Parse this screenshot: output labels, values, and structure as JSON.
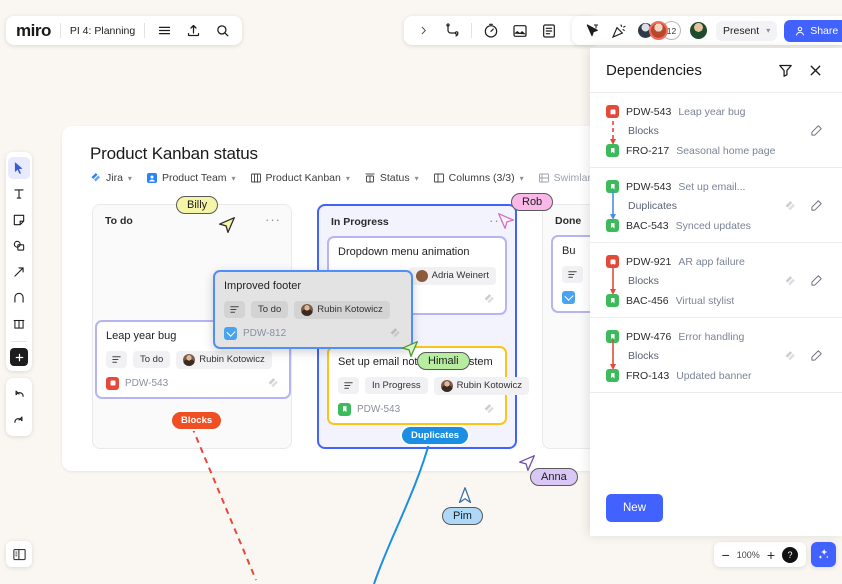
{
  "app": {
    "logo": "miro",
    "board_name": "PI 4: Planning",
    "present_label": "Present",
    "share_label": "Share",
    "avatar_overflow_count": "12"
  },
  "board": {
    "title": "Product Kanban status",
    "toolbar": [
      {
        "label": "Jira",
        "icon": "jira-icon"
      },
      {
        "label": "Product Team",
        "icon": "team-icon"
      },
      {
        "label": "Product Kanban",
        "icon": "board-icon"
      },
      {
        "label": "Status",
        "icon": "status-icon"
      },
      {
        "label": "Columns (3/3)",
        "icon": "columns-icon"
      },
      {
        "label": "Swimlanes",
        "icon": "swimlanes-icon"
      }
    ],
    "columns": [
      {
        "name": "To do"
      },
      {
        "name": "In Progress"
      },
      {
        "name": "Done"
      }
    ],
    "cards": {
      "leap_year": {
        "title": "Leap year bug",
        "status": "To do",
        "assignee": "Rubin Kotowicz",
        "key": "PDW-543"
      },
      "improved_footer": {
        "title": "Improved footer",
        "status": "To do",
        "assignee": "Rubin Kotowicz",
        "key": "PDW-812"
      },
      "dropdown": {
        "title": "Dropdown menu animation",
        "assignee": "Adria Weinert"
      },
      "email_notif": {
        "title": "Set up email notification system",
        "status": "In Progress",
        "assignee": "Rubin Kotowicz",
        "key": "PDW-543"
      },
      "done_card": {
        "title": "Bu"
      }
    },
    "connector_labels": {
      "blocks": "Blocks",
      "duplicates": "Duplicates"
    }
  },
  "cursors": [
    {
      "name": "Billy",
      "color": "#f5f5a8",
      "border": "#2b2b2b"
    },
    {
      "name": "Rob",
      "color": "#f9b8e8",
      "border": "#2b2b2b"
    },
    {
      "name": "Himali",
      "color": "#b7eda0",
      "border": "#2b2b2b"
    },
    {
      "name": "Anna",
      "color": "#d9c7f5",
      "border": "#2b2b2b"
    },
    {
      "name": "Pim",
      "color": "#aed8f7",
      "border": "#2b2b2b"
    }
  ],
  "dependencies_panel": {
    "title": "Dependencies",
    "new_button": "New",
    "items": [
      {
        "from_key": "PDW-543",
        "from_summary": "Leap year bug",
        "from_type": "red",
        "relation": "Blocks",
        "line": "dashed",
        "line_color": "#e5493a",
        "has_jira_mark": false,
        "to_key": "FRO-217",
        "to_summary": "Seasonal home page",
        "to_type": "green"
      },
      {
        "from_key": "PDW-543",
        "from_summary": "Set up email...",
        "from_type": "green",
        "relation": "Duplicates",
        "line": "solid",
        "line_color": "#4a90e2",
        "has_jira_mark": true,
        "to_key": "BAC-543",
        "to_summary": "Synced updates",
        "to_type": "green"
      },
      {
        "from_key": "PDW-921",
        "from_summary": "AR app failure",
        "from_type": "red",
        "relation": "Blocks",
        "line": "solid",
        "line_color": "#e5493a",
        "has_jira_mark": true,
        "to_key": "BAC-456",
        "to_summary": "Virtual stylist",
        "to_type": "green"
      },
      {
        "from_key": "PDW-476",
        "from_summary": "Error handling",
        "from_type": "green",
        "relation": "Blocks",
        "line": "solid",
        "line_color": "#e5493a",
        "has_jira_mark": true,
        "to_key": "FRO-143",
        "to_summary": "Updated banner",
        "to_type": "green"
      }
    ]
  },
  "zoom_controls": {
    "minus": "−",
    "level": "100%",
    "plus": "+",
    "help": "?"
  }
}
